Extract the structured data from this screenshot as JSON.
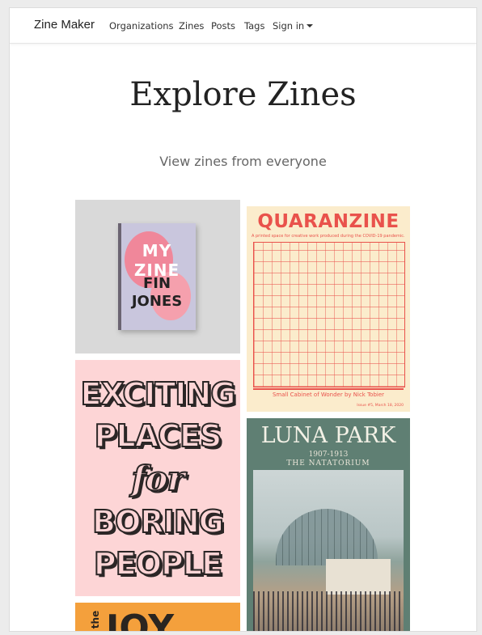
{
  "navbar": {
    "brand": "Zine Maker",
    "links": [
      "Organizations",
      "Zines",
      "Posts",
      "Tags"
    ],
    "signin": "Sign in"
  },
  "page": {
    "title": "Explore Zines",
    "subtitle": "View zines from everyone"
  },
  "zines": {
    "my_zine": {
      "line1": "MY ZINE",
      "line2": "FIN",
      "line3": "JONES"
    },
    "quaranzine": {
      "title": "QUARANZINE",
      "subtitle": "A printed space for creative work produced during the COVID-19 pandemic.",
      "caption": "Small Cabinet of Wonder by Nick Tobier",
      "issue": "Issue #5, March 18, 2020"
    },
    "exciting": {
      "l1": "EXCITING",
      "l2": "PLACES",
      "l3": "for",
      "l4": "BORING",
      "l5": "PEOPLE"
    },
    "luna_park": {
      "title": "LUNA PARK",
      "years": "1907-1913",
      "subtitle": "THE NATATORIUM"
    },
    "joy": {
      "the": "the",
      "word": "JOY"
    }
  },
  "colors": {
    "quaranzine_red": "#e9524c",
    "exciting_pink": "#fdd5d6",
    "luna_green": "#5f7f73",
    "joy_orange": "#f4a03c"
  }
}
